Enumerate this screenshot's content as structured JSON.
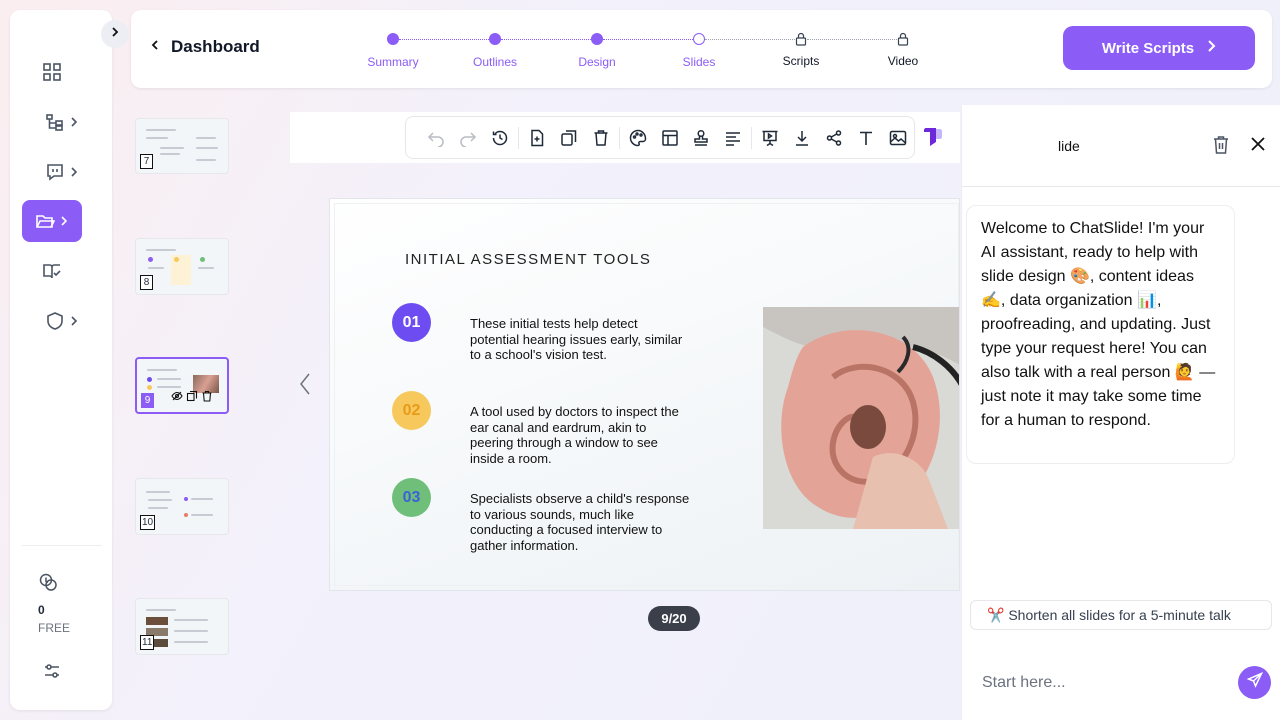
{
  "header": {
    "back_title": "Dashboard",
    "steps": [
      {
        "label": "Summary",
        "state": "done"
      },
      {
        "label": "Outlines",
        "state": "done"
      },
      {
        "label": "Design",
        "state": "done"
      },
      {
        "label": "Slides",
        "state": "current"
      },
      {
        "label": "Scripts",
        "state": "locked"
      },
      {
        "label": "Video",
        "state": "locked"
      }
    ],
    "write_button": "Write Scripts"
  },
  "sidebar": {
    "items": [
      {
        "icon": "dashboard-grid-icon"
      },
      {
        "icon": "outline-tree-icon"
      },
      {
        "icon": "chat-bubble-icon"
      },
      {
        "icon": "folder-open-icon",
        "active": true
      },
      {
        "icon": "book-check-icon"
      },
      {
        "icon": "shield-icon"
      }
    ],
    "credits": "0",
    "plan": "FREE"
  },
  "thumbnails": [
    {
      "num": "7"
    },
    {
      "num": "8"
    },
    {
      "num": "9",
      "selected": true
    },
    {
      "num": "10"
    },
    {
      "num": "11"
    }
  ],
  "toolbar": {
    "icons": [
      "undo-icon",
      "redo-icon",
      "history-icon",
      "add-slide-icon",
      "duplicate-icon",
      "delete-icon",
      "palette-icon",
      "layout-icon",
      "stamp-icon",
      "align-icon",
      "present-icon",
      "download-icon",
      "share-icon",
      "text-icon",
      "image-icon"
    ]
  },
  "slide": {
    "title": "INITIAL ASSESSMENT TOOLS",
    "bullets": [
      {
        "num": "01",
        "color": "#6d4df2",
        "text": "These initial tests help detect potential hearing issues early, similar to a school's vision test."
      },
      {
        "num": "02",
        "color": "#f7c95c",
        "text": "A tool used by doctors to inspect the ear canal and eardrum, akin to peering through a window to see inside a room."
      },
      {
        "num": "03",
        "color": "#6fbf7a",
        "text": "Specialists observe a child's response to various sounds, much like conducting a focused interview to gather information."
      }
    ],
    "page": "9/20"
  },
  "chat": {
    "title": "lide",
    "message": "Welcome to ChatSlide! I'm your AI assistant, ready to help with slide design 🎨, content ideas ✍️, data organization 📊, proofreading, and updating. Just type your request here! You can also talk with a real person 🙋 — just note it may take some time for a human to respond.",
    "suggestion": "✂️ Shorten all slides for a 5-minute talk",
    "input_placeholder": "Start here..."
  },
  "colors": {
    "accent": "#8b5cf6"
  }
}
